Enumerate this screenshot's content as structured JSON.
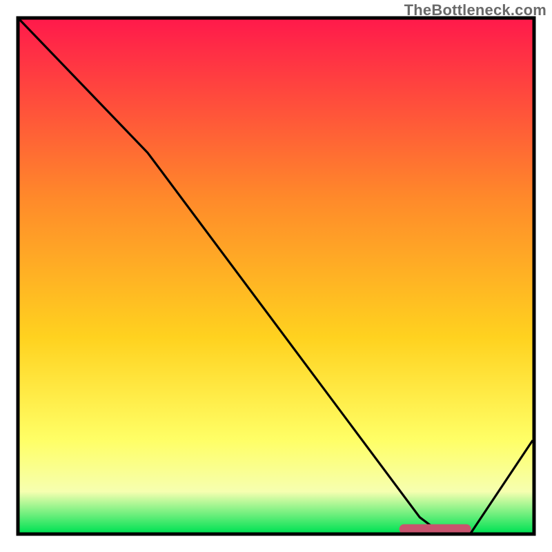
{
  "watermark": "TheBottleneck.com",
  "colors": {
    "gradient_top": "#ff1a4b",
    "gradient_upper_mid": "#ff8a2a",
    "gradient_mid": "#ffd21f",
    "gradient_lower_mid": "#ffff66",
    "gradient_band": "#f6ffb0",
    "gradient_bottom": "#00e254",
    "curve": "#000000",
    "marker": "#c8546e",
    "frame": "#000000"
  },
  "chart_data": {
    "type": "line",
    "title": "",
    "xlabel": "",
    "ylabel": "",
    "xlim": [
      0,
      100
    ],
    "ylim": [
      0,
      100
    ],
    "series": [
      {
        "name": "bottleneck-curve",
        "x": [
          0,
          25,
          28,
          78,
          82,
          88,
          100
        ],
        "values": [
          100,
          74,
          70,
          3,
          0,
          0,
          18
        ]
      }
    ],
    "annotations": [
      {
        "name": "optimal-range-marker",
        "shape": "rounded-bar",
        "x_start": 74,
        "x_end": 88,
        "y": 0.7,
        "color": "#c8546e"
      }
    ],
    "background": {
      "type": "vertical-gradient",
      "stops": [
        {
          "pos": 0,
          "color": "#ff1a4b"
        },
        {
          "pos": 35,
          "color": "#ff8a2a"
        },
        {
          "pos": 62,
          "color": "#ffd21f"
        },
        {
          "pos": 82,
          "color": "#ffff66"
        },
        {
          "pos": 92,
          "color": "#f6ffb0"
        },
        {
          "pos": 100,
          "color": "#00e254"
        }
      ]
    }
  }
}
